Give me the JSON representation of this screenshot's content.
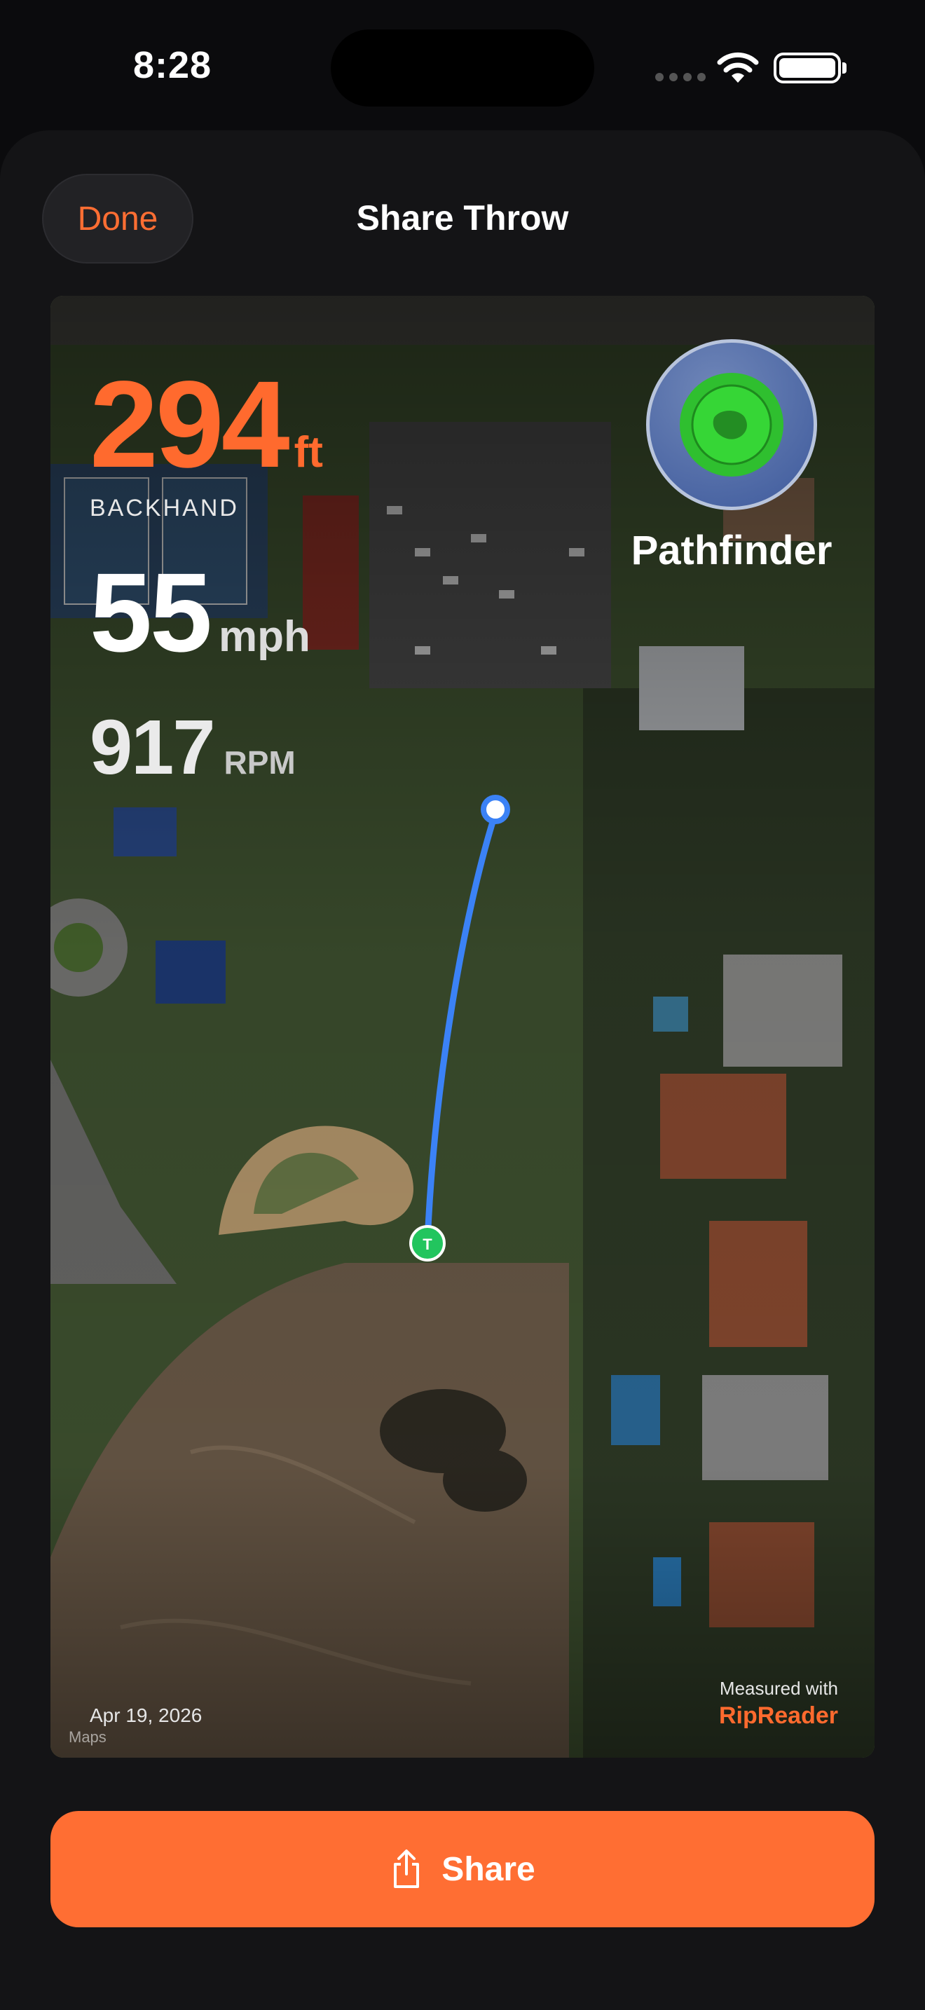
{
  "status_bar": {
    "time": "8:28"
  },
  "header": {
    "done_label": "Done",
    "title": "Share Throw"
  },
  "throw": {
    "distance": "294",
    "distance_unit": "ft",
    "throw_type": "BACKHAND",
    "speed": "55",
    "speed_unit": "mph",
    "spin": "917",
    "spin_unit": "RPM",
    "disc_name": "Pathfinder",
    "date": "Apr 19, 2026",
    "tee_marker": "T"
  },
  "footer": {
    "measured_with": "Measured with",
    "brand": "RipReader",
    "maps_credit": "Maps"
  },
  "share": {
    "label": "Share"
  },
  "colors": {
    "accent": "#ff6e33",
    "path": "#3b82f6",
    "tee": "#22c55e",
    "background": "#141416"
  },
  "icons": [
    "wifi-icon",
    "battery-icon",
    "share-icon",
    "disc-icon",
    "tee-marker-icon",
    "landing-marker-icon"
  ]
}
